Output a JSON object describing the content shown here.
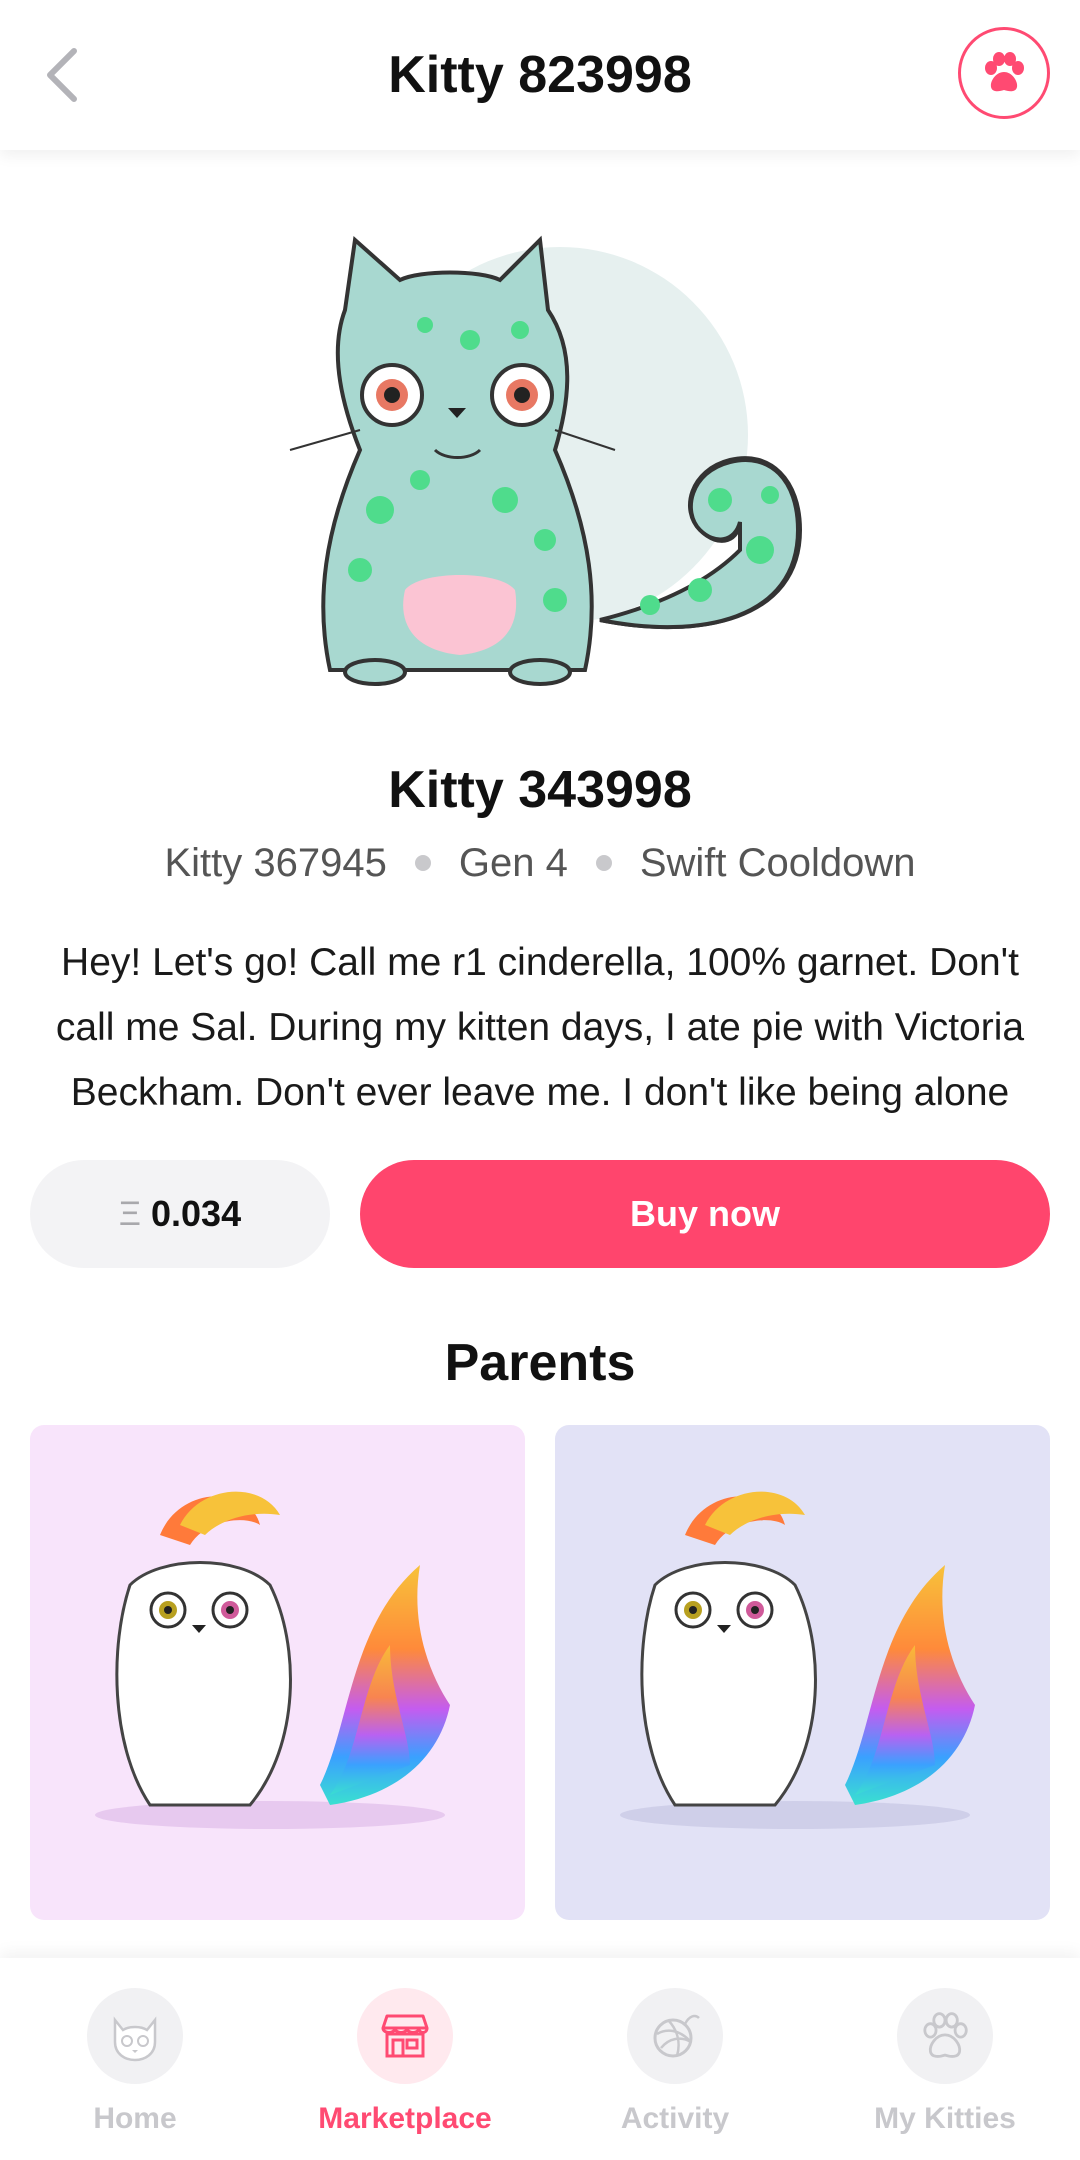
{
  "header": {
    "title": "Kitty 823998",
    "back_icon": "chevron-left-icon",
    "action_icon": "paw-icon",
    "accent": "#ff4a72"
  },
  "kitty": {
    "name": "Kitty 343998",
    "meta": [
      "Kitty 367945",
      "Gen 4",
      "Swift Cooldown"
    ],
    "bio": "Hey! Let's go! Call me r1 cinderella, 100% garnet. Don't call me Sal. During my kitten days, I ate pie with Victoria Beckham. Don't ever leave me. I don't like being alone"
  },
  "purchase": {
    "currency_symbol": "Ξ",
    "price": "0.034",
    "buy_label": "Buy now",
    "buy_color": "#ff456d"
  },
  "parents": {
    "heading": "Parents",
    "cards": [
      {
        "bg": "#f8e4fb"
      },
      {
        "bg": "#e2e2f6"
      }
    ]
  },
  "nav": {
    "items": [
      {
        "label": "Home",
        "icon": "cat-face-icon",
        "active": false
      },
      {
        "label": "Marketplace",
        "icon": "storefront-icon",
        "active": true
      },
      {
        "label": "Activity",
        "icon": "yarn-ball-icon",
        "active": false
      },
      {
        "label": "My Kitties",
        "icon": "paw-icon",
        "active": false
      }
    ]
  }
}
